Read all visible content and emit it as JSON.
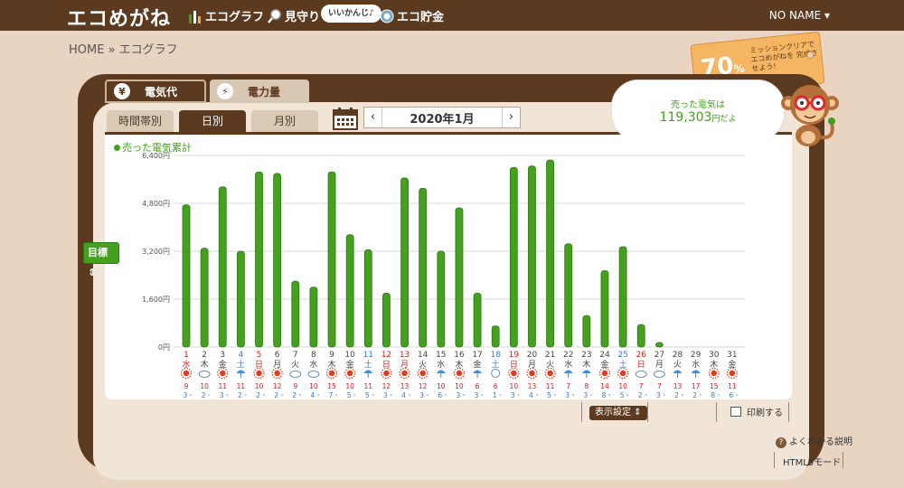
{
  "header": {
    "logo": "エコめがね",
    "nav": [
      {
        "label": "エコグラフ",
        "icon": "bar-chart-icon"
      },
      {
        "label": "見守り",
        "icon": "magnifier-icon"
      },
      {
        "label": "エコ貯金",
        "icon": "coin-icon"
      }
    ],
    "bubble": "いいかんじ♪",
    "user": "NO NAME ▾"
  },
  "breadcrumb": {
    "home": "HOME",
    "sep": " » ",
    "current": "エコグラフ"
  },
  "mission_tag": {
    "percent": "70",
    "unit": "%",
    "text": "ミッションクリアで エコめがねを 完成させよう!"
  },
  "tabs": {
    "main": [
      {
        "label": "電気代",
        "icon": "¥"
      },
      {
        "label": "電力量",
        "icon": "⚡"
      }
    ],
    "sub": [
      "時間帯別",
      "日別",
      "月別"
    ]
  },
  "month": {
    "label": "2020年1月",
    "prev": "‹",
    "next": "›"
  },
  "sold": {
    "line1": "売った電気は",
    "amount": "119,303",
    "unit": "円だよ"
  },
  "legend": "売った電気累計",
  "target_button": "目標 ⇕",
  "display_settings": "表示設定 ⇕",
  "print": "印刷する",
  "help": "よくわかる説明",
  "html5": "HTML5モード",
  "colors": {
    "bar": "#44a01d",
    "bar_dark": "#2e7813",
    "brown": "#5b3a1f",
    "red": "#d42020",
    "blue": "#3a7ad0",
    "sun": "#e23a1a"
  },
  "chart_data": {
    "type": "bar",
    "ylim": [
      0,
      6400
    ],
    "yticks": [
      "0円",
      "1,600円",
      "3,200円",
      "4,800円",
      "6,400円"
    ],
    "ytick_values": [
      0,
      1600,
      3200,
      4800,
      6400
    ],
    "days": [
      "1",
      "2",
      "3",
      "4",
      "5",
      "6",
      "7",
      "8",
      "9",
      "10",
      "11",
      "12",
      "13",
      "14",
      "15",
      "16",
      "17",
      "18",
      "19",
      "20",
      "21",
      "22",
      "23",
      "24",
      "25",
      "26",
      "27",
      "28",
      "29",
      "30",
      "31"
    ],
    "weekdays": [
      "水",
      "木",
      "金",
      "土",
      "日",
      "月",
      "火",
      "水",
      "木",
      "金",
      "土",
      "日",
      "月",
      "火",
      "水",
      "木",
      "金",
      "土",
      "日",
      "月",
      "火",
      "水",
      "木",
      "金",
      "土",
      "日",
      "月",
      "火",
      "水",
      "木",
      "金"
    ],
    "day_colors": [
      "red",
      "dark",
      "dark",
      "blue",
      "red",
      "dark",
      "dark",
      "dark",
      "dark",
      "dark",
      "blue",
      "red",
      "red",
      "dark",
      "dark",
      "dark",
      "dark",
      "blue",
      "red",
      "dark",
      "dark",
      "dark",
      "dark",
      "dark",
      "blue",
      "red",
      "dark",
      "dark",
      "dark",
      "dark",
      "dark"
    ],
    "values": [
      4750,
      3300,
      5350,
      3200,
      5850,
      5800,
      2200,
      2000,
      5850,
      3750,
      3250,
      1800,
      5650,
      5300,
      3200,
      4650,
      1800,
      700,
      6000,
      6050,
      6250,
      3450,
      1050,
      2550,
      3350,
      750,
      150,
      0,
      0,
      0,
      0
    ],
    "weather": [
      "sun",
      "cloud",
      "sun",
      "umbrella",
      "sun",
      "sun",
      "cloud",
      "cloud",
      "sun",
      "sun",
      "umbrella",
      "sun",
      "sun",
      "sun",
      "umbrella",
      "sun",
      "umbrella",
      "snow",
      "sun",
      "sun",
      "sun",
      "umbrella",
      "umbrella",
      "sun",
      "sun",
      "cloud",
      "cloud",
      "umbrella",
      "umbrella",
      "sun",
      "sun"
    ],
    "temp_high": [
      "9",
      "10",
      "11",
      "11",
      "10",
      "12",
      "9",
      "10",
      "15",
      "10",
      "11",
      "12",
      "13",
      "12",
      "10",
      "10",
      "6",
      "6",
      "10",
      "13",
      "11",
      "7",
      "8",
      "14",
      "10",
      "7",
      "7",
      "13",
      "17",
      "15",
      "11"
    ],
    "temp_low": [
      "3",
      "2",
      "3",
      "2",
      "2",
      "2",
      "2",
      "4",
      "7",
      "5",
      "5",
      "3",
      "4",
      "3",
      "6",
      "3",
      "3",
      "1",
      "3",
      "4",
      "5",
      "3",
      "3",
      "8",
      "5",
      "2",
      "3",
      "2",
      "2",
      "8",
      "6"
    ]
  }
}
